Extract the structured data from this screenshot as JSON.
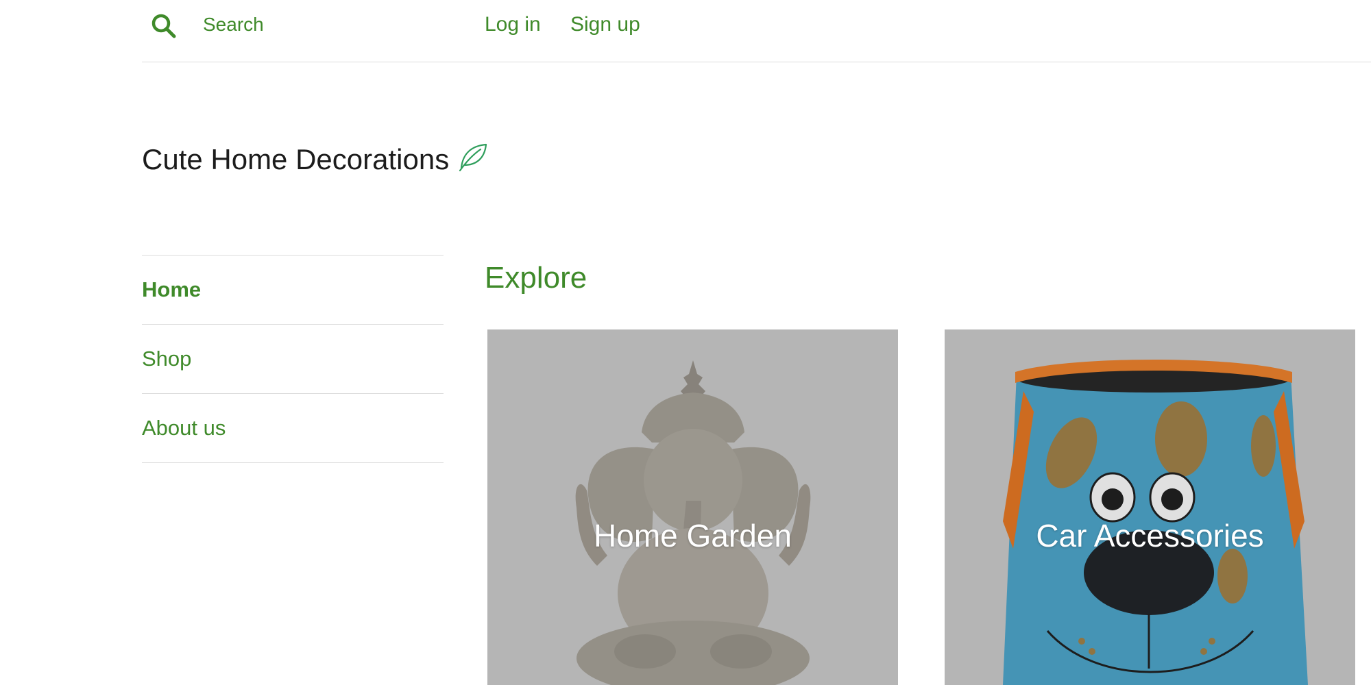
{
  "header": {
    "search_label": "Search",
    "login_label": "Log in",
    "signup_label": "Sign up",
    "icons": [
      "search-icon"
    ]
  },
  "brand": {
    "title": "Cute Home Decorations",
    "icon": "leaf-icon"
  },
  "sidebar": {
    "items": [
      {
        "label": "Home",
        "active": true
      },
      {
        "label": "Shop",
        "active": false
      },
      {
        "label": "About us",
        "active": false
      }
    ]
  },
  "main": {
    "title": "Explore",
    "categories": [
      {
        "label": "Home Garden",
        "image": "ganesha-statue"
      },
      {
        "label": "Car Accessories",
        "image": "dog-face-storage-bin"
      }
    ]
  },
  "colors": {
    "accent": "#3f8a2a",
    "text": "#1c1c1c",
    "divider": "#dcdcdc",
    "card_bg": "#cecece",
    "leaf": "#2e9e5b"
  }
}
